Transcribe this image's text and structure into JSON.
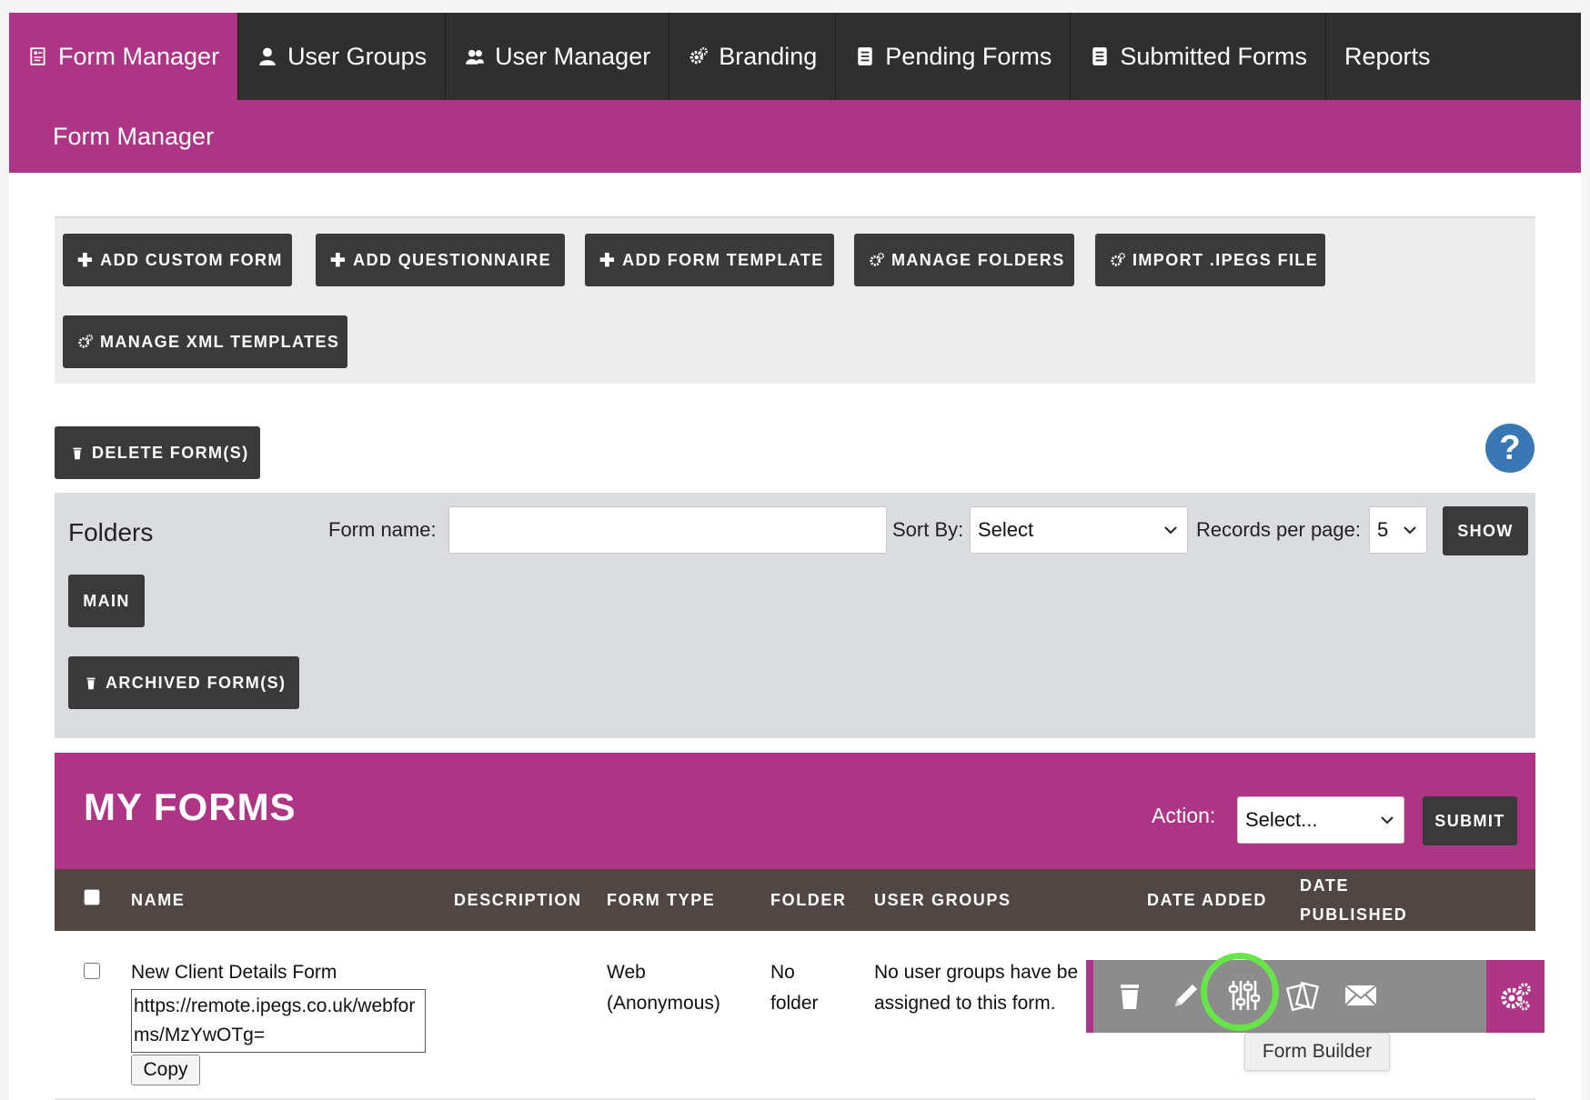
{
  "nav": {
    "items": [
      {
        "label": "Form Manager",
        "icon": "form-icon"
      },
      {
        "label": "User Groups",
        "icon": "user-icon"
      },
      {
        "label": "User Manager",
        "icon": "users-icon"
      },
      {
        "label": "Branding",
        "icon": "gears-icon"
      },
      {
        "label": "Pending Forms",
        "icon": "document-icon"
      },
      {
        "label": "Submitted Forms",
        "icon": "document-icon"
      },
      {
        "label": "Reports",
        "icon": ""
      }
    ],
    "active": "Form Manager"
  },
  "subheader": {
    "title": "Form Manager"
  },
  "toolbar": {
    "add_custom_form": "ADD CUSTOM FORM",
    "add_questionnaire": "ADD QUESTIONNAIRE",
    "add_form_template": "ADD FORM TEMPLATE",
    "manage_folders": "MANAGE FOLDERS",
    "import_ipegs": "IMPORT .IPEGS FILE",
    "manage_xml": "MANAGE XML TEMPLATES",
    "delete_forms": "DELETE FORM(S)"
  },
  "help": {
    "symbol": "?"
  },
  "filters": {
    "folders_title": "Folders",
    "form_name_label": "Form name:",
    "form_name_value": "",
    "sort_by_label": "Sort By:",
    "sort_by_value": "Select",
    "records_label": "Records per page:",
    "records_value": "5",
    "show_label": "SHOW",
    "folder_main": "MAIN",
    "archived": "ARCHIVED FORM(S)"
  },
  "my_forms": {
    "title": "MY FORMS",
    "action_label": "Action:",
    "action_value": "Select...",
    "submit_label": "SUBMIT",
    "columns": {
      "name": "NAME",
      "description": "DESCRIPTION",
      "form_type": "FORM TYPE",
      "folder": "FOLDER",
      "user_groups": "USER GROUPS",
      "date_added": "DATE ADDED",
      "date_published_1": "DATE",
      "date_published_2": "PUBLISHED"
    },
    "rows": [
      {
        "name": "New Client Details Form",
        "url": "https://remote.ipegs.co.uk/webforms/MzYwOTg=",
        "copy_label": "Copy",
        "description": "",
        "form_type_1": "Web",
        "form_type_2": "(Anonymous)",
        "folder_1": "No",
        "folder_2": "folder",
        "user_groups_1": "No user groups have be",
        "user_groups_2": "assigned to this form."
      }
    ],
    "tooltip": "Form Builder"
  },
  "colors": {
    "brand": "#ae3585",
    "nav_bg": "#2f2f2f",
    "button": "#3a3a3a",
    "highlight": "#66e44a",
    "help": "#3a78b5"
  }
}
